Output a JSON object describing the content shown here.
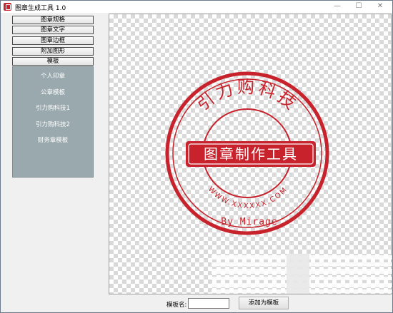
{
  "window": {
    "title": "图章生成工具 1.0",
    "minimize_glyph": "—",
    "maximize_glyph": "☐",
    "close_glyph": "✕"
  },
  "left_menu": {
    "buttons": [
      {
        "label": "图章规格"
      },
      {
        "label": "图章文字"
      },
      {
        "label": "图章边框"
      },
      {
        "label": "附加图形"
      },
      {
        "label": "模板"
      }
    ],
    "template_items": [
      {
        "label": "个人印章"
      },
      {
        "label": "公章模板"
      },
      {
        "label": "引力购科技1"
      },
      {
        "label": "引力购科技2"
      },
      {
        "label": "财务章模板"
      }
    ]
  },
  "seal": {
    "color": "#c8232c",
    "arc_top_text": "引力购科技",
    "arc_bottom_text": "WWW.XXXXXX.COM",
    "banner_text": "图章制作工具",
    "signature_text": "By Mirage"
  },
  "bottom_bar": {
    "template_name_label": "模板名:",
    "template_name_value": "",
    "add_button_label": "添加为模板"
  },
  "colors": {
    "panel_bg": "#9aa9ae",
    "accent_red": "#c8232c"
  }
}
